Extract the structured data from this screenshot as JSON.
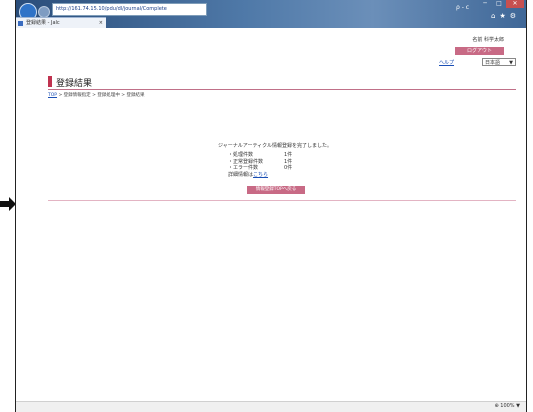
{
  "browser": {
    "address_url": "http://161.74.15.10/pdu/dl/journal/Complete",
    "address_extra": "ρ - c",
    "tab_title": "登録結果 - Jalc",
    "tab_close": "×",
    "toolbar_icons": "⌂★⚙",
    "window_controls": [
      "─",
      "□",
      "✕"
    ],
    "zoom": "⊕ 100% ▼"
  },
  "header": {
    "user": "名前 科学太郎",
    "logout": "ログアウト",
    "help": "ヘルプ",
    "language": "日本語",
    "language_caret": "▼"
  },
  "page": {
    "title": "登録結果",
    "breadcrumb": {
      "top": "TOP",
      "sep": ">",
      "step1": "登録情報指定",
      "step2": "登録処理中",
      "step3": "登録結果"
    },
    "message": "ジャーナルアーティクル情報登録を完了しました。",
    "stats": [
      {
        "label": "・処理件数",
        "value": "1件"
      },
      {
        "label": "・正常登録件数",
        "value": "1件"
      },
      {
        "label": "・エラー件数",
        "value": "0件"
      }
    ],
    "detail_label": "詳細情報は",
    "detail_link": "こちら",
    "return_button": "情報登録TOPへ戻る"
  },
  "colors": {
    "accent": "#c86a85",
    "title_bar": "#c0324f",
    "link": "#1a4fb5"
  }
}
